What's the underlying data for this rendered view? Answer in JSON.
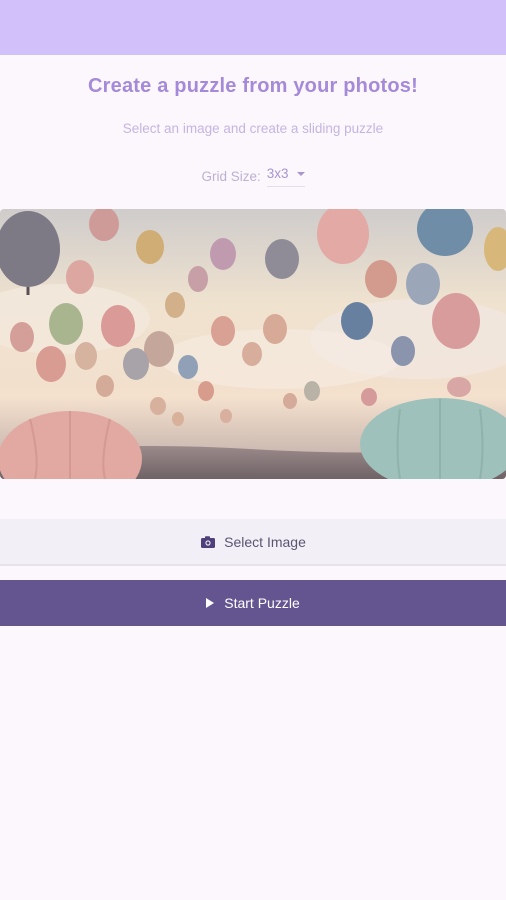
{
  "header": {
    "title": "Create a puzzle from your photos!",
    "subtitle": "Select an image and create a sliding puzzle"
  },
  "grid": {
    "label": "Grid Size:",
    "value": "3x3"
  },
  "actions": {
    "select_label": "Select Image",
    "start_label": "Start Puzzle"
  },
  "image": {
    "description_icon": "hot-air-balloons-photo"
  },
  "colors": {
    "appbar": "#d2c0fb",
    "accent": "#a48ad8",
    "primary_button": "#645590"
  }
}
